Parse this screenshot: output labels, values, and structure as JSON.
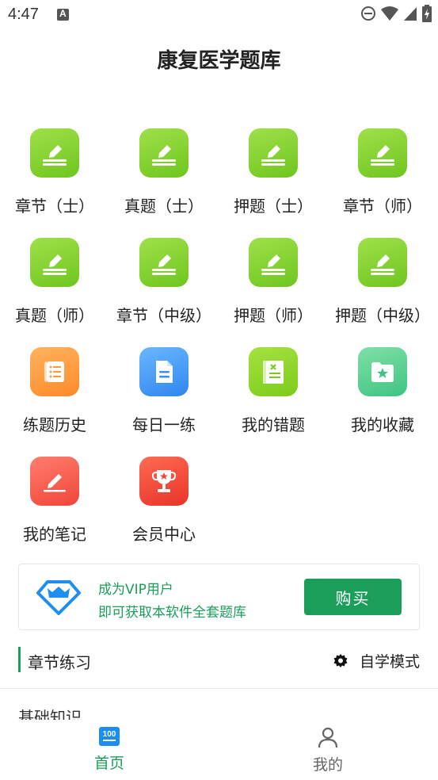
{
  "status_bar": {
    "time": "4:47"
  },
  "page_title": "康复医学题库",
  "grid": [
    {
      "label": "章节（士）",
      "icon": "edit-icon",
      "style": "green"
    },
    {
      "label": "真题（士）",
      "icon": "edit-icon",
      "style": "green"
    },
    {
      "label": "押题（士）",
      "icon": "edit-icon",
      "style": "green"
    },
    {
      "label": "章节（师）",
      "icon": "edit-icon",
      "style": "green"
    },
    {
      "label": "真题（师）",
      "icon": "edit-icon",
      "style": "green"
    },
    {
      "label": "章节（中级）",
      "icon": "edit-icon",
      "style": "green"
    },
    {
      "label": "押题（师）",
      "icon": "edit-icon",
      "style": "green"
    },
    {
      "label": "押题（中级）",
      "icon": "edit-icon",
      "style": "green"
    },
    {
      "label": "练题历史",
      "icon": "scroll-list-icon",
      "style": "orange"
    },
    {
      "label": "每日一练",
      "icon": "document-icon",
      "style": "blue"
    },
    {
      "label": "我的错题",
      "icon": "wrong-book-icon",
      "style": "lime"
    },
    {
      "label": "我的收藏",
      "icon": "star-folder-icon",
      "style": "teal"
    },
    {
      "label": "我的笔记",
      "icon": "note-pen-icon",
      "style": "red"
    },
    {
      "label": "会员中心",
      "icon": "trophy-icon",
      "style": "red2"
    }
  ],
  "vip": {
    "line1": "成为VIP用户",
    "line2": "即可获取本软件全套题库",
    "buy_label": "购买",
    "accent": "#1a9e5a"
  },
  "section": {
    "title": "章节练习",
    "mode_label": "自学模式"
  },
  "list_peek": "基础知识",
  "tabs": [
    {
      "label": "首页",
      "icon": "home-100-icon",
      "active": true
    },
    {
      "label": "我的",
      "icon": "person-icon",
      "active": false
    }
  ]
}
